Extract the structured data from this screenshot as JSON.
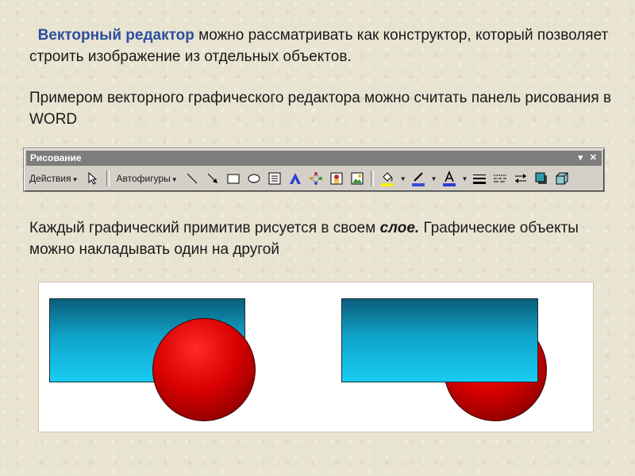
{
  "paragraph1": {
    "highlight": "Векторный редактор",
    "rest": " можно рассматривать как конструктор, который позволяет строить  изображение из отдельных объектов."
  },
  "paragraph2": {
    "text": "Примером векторного графического редактора можно считать панель рисования в WORD"
  },
  "toolbar": {
    "title": "Рисование",
    "actions_menu": "Действия",
    "autoshapes_menu": "Автофигуры",
    "title_bar_color": "#7d7d7d"
  },
  "paragraph3": {
    "before": "Каждый графический примитив рисуется в своем ",
    "emphasis": "слое.",
    "after": " Графические объекты можно накладывать один на другой"
  },
  "illustration": {
    "rect_color": "#18cdf3",
    "circle_color": "#d80000"
  }
}
